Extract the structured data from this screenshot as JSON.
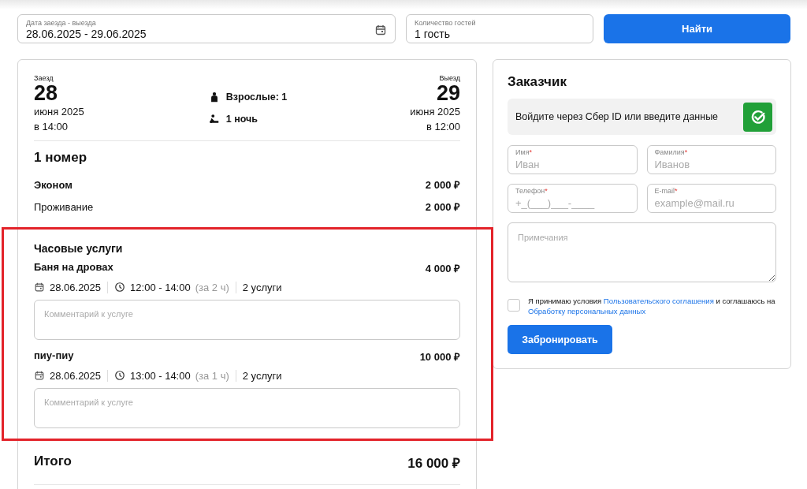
{
  "search": {
    "dates": {
      "label": "Дата заезда - выезда",
      "value": "28.06.2025 - 29.06.2025"
    },
    "guests": {
      "label": "Количество гостей",
      "value": "1 гость"
    },
    "button": "Найти"
  },
  "summary": {
    "checkin": {
      "label": "Заезд",
      "day": "28",
      "month": "июня 2025",
      "time": "в 14:00"
    },
    "adults": "Взрослые: 1",
    "nights": "1 ночь",
    "checkout": {
      "label": "Выезд",
      "day": "29",
      "month": "июня 2025",
      "time": "в 12:00"
    },
    "rooms_title": "1 номер",
    "lines": [
      {
        "kind": "room",
        "label": "Эконом",
        "price": "2 000 ₽"
      },
      {
        "kind": "item",
        "label": "Проживание",
        "price": "2 000 ₽"
      }
    ],
    "services_title": "Часовые услуги",
    "services": [
      {
        "name": "Баня на дровах",
        "price": "4 000 ₽",
        "date": "28.06.2025",
        "time": "12:00 - 14:00",
        "duration": "(за 2 ч)",
        "count": "2 услуги",
        "comment_placeholder": "Комментарий к услуге"
      },
      {
        "name": "пиу-пиу",
        "price": "10 000 ₽",
        "date": "28.06.2025",
        "time": "13:00 - 14:00",
        "duration": "(за 1 ч)",
        "count": "2 услуги",
        "comment_placeholder": "Комментарий к услуге"
      }
    ],
    "total_label": "Итого",
    "total": "16 000 ₽"
  },
  "customer": {
    "title": "Заказчик",
    "sber_text": "Войдите через Сбер ID или введите данные",
    "fields": [
      {
        "label": "Имя",
        "mark": "*",
        "placeholder": "Иван"
      },
      {
        "label": "Фамилия",
        "mark": "*",
        "placeholder": "Иванов"
      },
      {
        "label": "Телефон",
        "mark": "*",
        "placeholder": "+_(___)___-____"
      },
      {
        "label": "E-mail",
        "mark": "*",
        "placeholder": "example@mail.ru"
      }
    ],
    "notes_placeholder": "Примечания",
    "consent": {
      "checked": false,
      "parts": [
        {
          "kind": "text",
          "text": "Я принимаю условия "
        },
        {
          "kind": "link",
          "text": "Пользовательского соглашения"
        },
        {
          "kind": "text",
          "text": " и соглашаюсь на "
        },
        {
          "kind": "link",
          "text": "Обработку персональных данных"
        }
      ]
    },
    "button": "Забронировать"
  }
}
